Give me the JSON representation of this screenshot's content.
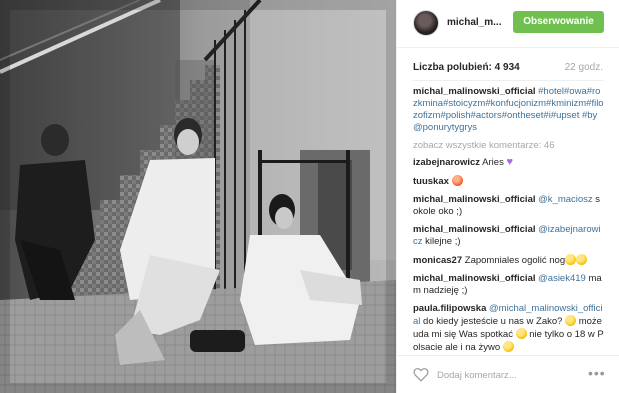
{
  "header": {
    "username": "michal_m...",
    "follow_label": "Obserwowanie"
  },
  "stats": {
    "likes": "Liczba polubień: 4 934",
    "time_ago": "22 godz."
  },
  "caption": {
    "user": "michal_malinowski_official",
    "text": " #hotel#owa#rozkmina#stoicyzm#konfucjonizm#kminizm#filozofizm#polish#actors#ontheset#i#upset #by @ponurytygrys"
  },
  "load_more": "zobacz wszystkie komentarze: 46",
  "comments": [
    {
      "user": "izabejnarowicz",
      "text": " Aries ",
      "emoji": "heart"
    },
    {
      "user": "tuuskax",
      "text": " ",
      "emoji": "red"
    },
    {
      "user": "michal_malinowski_official",
      "mention": " @k_maciosz",
      "text": " sokole oko ;)"
    },
    {
      "user": "michal_malinowski_official",
      "mention": " @izabejnarowicz",
      "text": " kilejne ;)"
    },
    {
      "user": "monicas27",
      "text": " Zapomniales ogolić nog",
      "emoji": "yellow"
    },
    {
      "user": "michal_malinowski_official",
      "mention": " @asiek419",
      "text": " mam nadzieję ;)"
    },
    {
      "user": "paula.filipowska",
      "mention": " @michal_malinowski_official",
      "text": " do kiedy jesteście u nas w Zako? ",
      "text2": " może uda mi się Was spotkać ",
      "text3": " nie tylko o 18 w Polsacie ale i na żywo "
    }
  ],
  "footer": {
    "comment_placeholder": "Dodaj komentarz...",
    "like_icon": "heart-outline-icon",
    "more_icon": "more-dots-icon"
  },
  "colors": {
    "follow_bg": "#70c050",
    "link": "#3f729b",
    "muted": "#a5a7aa"
  }
}
